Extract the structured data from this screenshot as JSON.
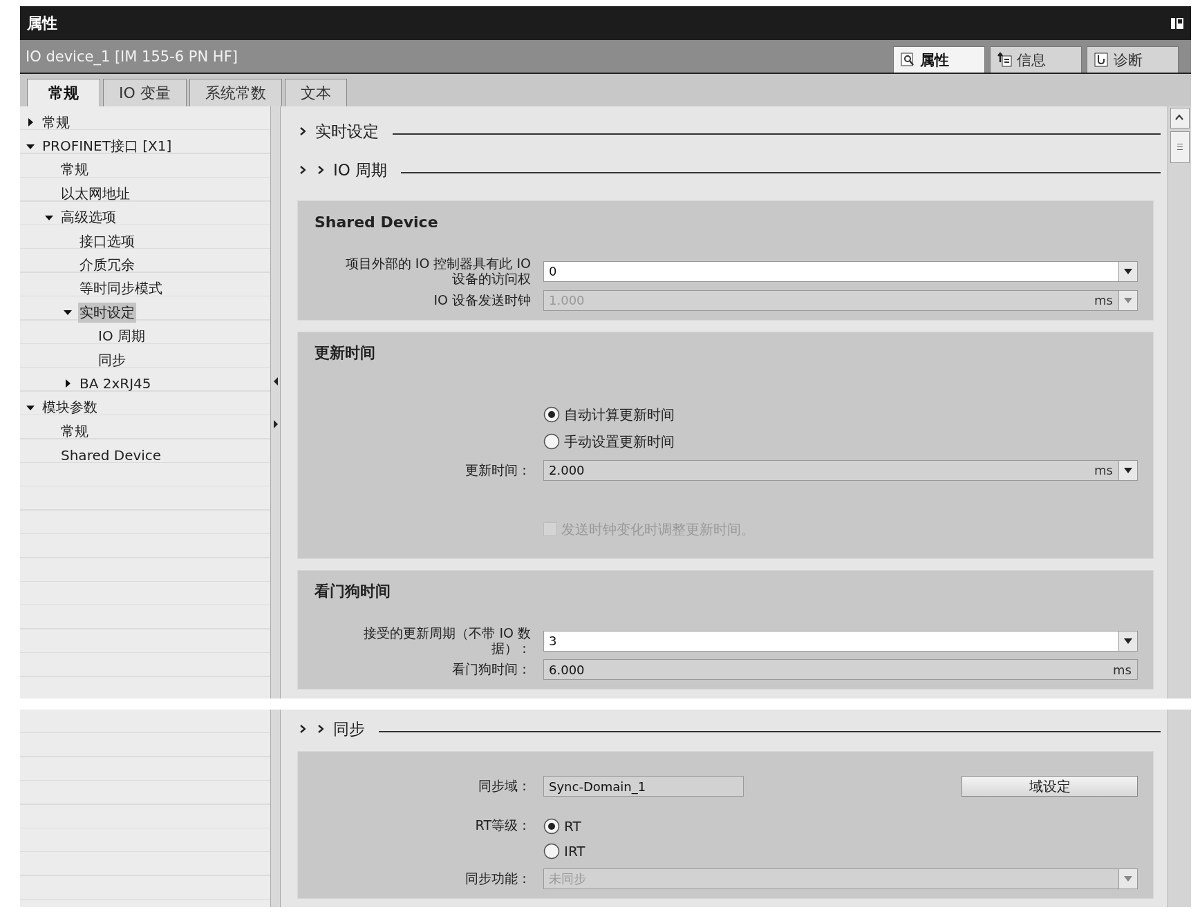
{
  "title": "属性",
  "object_name": "IO device_1 [IM 155-6 PN HF]",
  "inspector_tabs": [
    {
      "label": "属性",
      "selected": true,
      "kind": "properties"
    },
    {
      "label": "信息",
      "selected": false,
      "kind": "info"
    },
    {
      "label": "诊断",
      "selected": false,
      "kind": "diagnostics"
    }
  ],
  "tabs": [
    {
      "label": "常规",
      "selected": true
    },
    {
      "label": "IO 变量",
      "selected": false
    },
    {
      "label": "系统常数",
      "selected": false
    },
    {
      "label": "文本",
      "selected": false
    }
  ],
  "tree": [
    {
      "label": "常规",
      "expanded": false,
      "selected": false
    },
    {
      "label": "PROFINET接口 [X1]",
      "expanded": true,
      "selected": false,
      "children": [
        {
          "label": "常规",
          "selected": false
        },
        {
          "label": "以太网地址",
          "selected": false
        },
        {
          "label": "高级选项",
          "expanded": true,
          "selected": false,
          "children": [
            {
              "label": "接口选项",
              "selected": false
            },
            {
              "label": "介质冗余",
              "selected": false
            },
            {
              "label": "等时同步模式",
              "selected": false
            },
            {
              "label": "实时设定",
              "expanded": true,
              "selected": true,
              "children": [
                {
                  "label": "IO 周期",
                  "selected": false
                },
                {
                  "label": "同步",
                  "selected": false
                }
              ]
            },
            {
              "label": "BA 2xRJ45",
              "expanded": false,
              "selected": false
            }
          ]
        }
      ]
    },
    {
      "label": "模块参数",
      "expanded": true,
      "selected": false,
      "children": [
        {
          "label": "常规",
          "selected": false
        },
        {
          "label": "Shared Device",
          "selected": false
        }
      ]
    }
  ],
  "content": [
    {
      "kind": "section_heading",
      "label": "实时设定"
    },
    {
      "kind": "subsection_heading",
      "label": "IO 周期"
    },
    {
      "kind": "group",
      "title": "Shared Device",
      "rows": [
        {
          "kind": "field",
          "label": "项目外部的 IO 控制器具有此 IO 设备的访问权",
          "value": "0",
          "editable": true,
          "disabled": false,
          "dropdown": true
        },
        {
          "kind": "field",
          "label": "IO 设备发送时钟",
          "value": "1.000",
          "unit": "ms",
          "editable": false,
          "disabled": true,
          "dropdown": true
        }
      ]
    },
    {
      "kind": "group",
      "title": "更新时间",
      "rows": [
        {
          "kind": "radio_group",
          "options": [
            {
              "label": "自动计算更新时间",
              "selected": true
            },
            {
              "label": "手动设置更新时间",
              "selected": false
            }
          ]
        },
        {
          "kind": "field",
          "label": "更新时间：",
          "value": "2.000",
          "unit": "ms",
          "editable": false,
          "disabled": false,
          "dropdown": true
        },
        {
          "kind": "checkbox",
          "label": "发送时钟变化时调整更新时间。",
          "checked": false,
          "disabled": true
        }
      ]
    },
    {
      "kind": "group",
      "title": "看门狗时间",
      "rows": [
        {
          "kind": "field",
          "label": "接受的更新周期（不带 IO 数据）：",
          "value": "3",
          "editable": true,
          "disabled": false,
          "dropdown": true
        },
        {
          "kind": "field",
          "label": "看门狗时间：",
          "value": "6.000",
          "unit": "ms",
          "editable": false,
          "disabled": false,
          "dropdown": false
        }
      ]
    }
  ],
  "continued_content": [
    {
      "kind": "subsection_heading",
      "label": "同步"
    },
    {
      "kind": "group",
      "rows": [
        {
          "kind": "short_field",
          "label": "同步域：",
          "value": "Sync-Domain_1",
          "button": "域设定"
        },
        {
          "kind": "radio_group",
          "label": "RT等级：",
          "options": [
            {
              "label": "RT",
              "selected": true
            },
            {
              "label": "IRT",
              "selected": false
            }
          ]
        },
        {
          "kind": "field",
          "label": "同步功能：",
          "value": "未同步",
          "editable": false,
          "disabled": true,
          "dropdown": true
        }
      ]
    }
  ]
}
